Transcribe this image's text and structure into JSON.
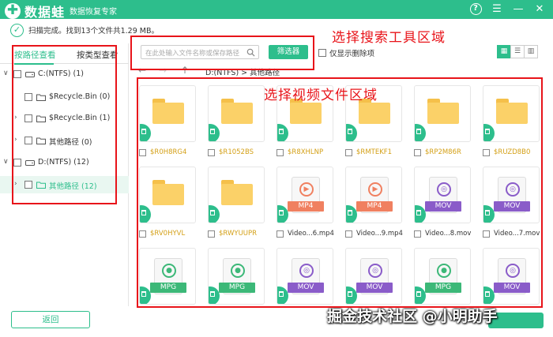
{
  "app": {
    "name": "数据蛙",
    "subtitle": "数据恢复专家"
  },
  "status": {
    "text": "扫描完成。找到13个文件共1.29 MB。"
  },
  "left_tabs": {
    "by_path": "按路径查看",
    "by_type": "按类型查看"
  },
  "tree": [
    {
      "label": "C:(NTFS) (1)",
      "caret": "∨"
    },
    {
      "label": "$Recycle.Bin (0)",
      "caret": ""
    },
    {
      "label": "$Recycle.Bin (1)",
      "caret": "›"
    },
    {
      "label": "其他路径 (0)",
      "caret": "›"
    },
    {
      "label": "D:(NTFS) (12)",
      "caret": "∨"
    },
    {
      "label": "其他路径 (12)",
      "caret": "›"
    }
  ],
  "buttons": {
    "back": "返回",
    "filter": "筛选器"
  },
  "search": {
    "placeholder": "在此处输入文件名称或保存路径"
  },
  "deleted_option": "仅显示删除项",
  "path": "D:(NTFS) > 其他路径",
  "annotations": {
    "search_area": "选择搜索工具区域",
    "video_area": "选择视频文件区域"
  },
  "files": [
    {
      "name": "$R0H8RG4",
      "kind": "folder"
    },
    {
      "name": "$R1052BS",
      "kind": "folder"
    },
    {
      "name": "$R8XHLNP",
      "kind": "folder"
    },
    {
      "name": "$RMTEKF1",
      "kind": "folder"
    },
    {
      "name": "$RP2M86R",
      "kind": "folder"
    },
    {
      "name": "$RUZD8B0",
      "kind": "folder"
    },
    {
      "name": "$RV0HYVL",
      "kind": "folder"
    },
    {
      "name": "$RWYUUPR",
      "kind": "folder"
    },
    {
      "name": "Video...6.mp4",
      "kind": "video",
      "format": "MP4"
    },
    {
      "name": "Video...9.mp4",
      "kind": "video",
      "format": "MP4"
    },
    {
      "name": "Video...8.mov",
      "kind": "video",
      "format": "MOV"
    },
    {
      "name": "Video...7.mov",
      "kind": "video",
      "format": "MOV"
    },
    {
      "name": "",
      "kind": "video",
      "format": "MPG"
    },
    {
      "name": "",
      "kind": "video",
      "format": "MPG"
    },
    {
      "name": "",
      "kind": "video",
      "format": "MOV"
    },
    {
      "name": "",
      "kind": "video",
      "format": "MOV"
    },
    {
      "name": "",
      "kind": "video",
      "format": "MPG"
    },
    {
      "name": "",
      "kind": "video",
      "format": "MOV"
    }
  ],
  "watermark": "掘金技术社区 @小明助手",
  "colors": {
    "brand": "#2dbe8c",
    "annotation": "#e8141a",
    "folder": "#fbd168",
    "mp4": "#f08060",
    "mov": "#8a5cc9",
    "mpg": "#3cb878"
  }
}
